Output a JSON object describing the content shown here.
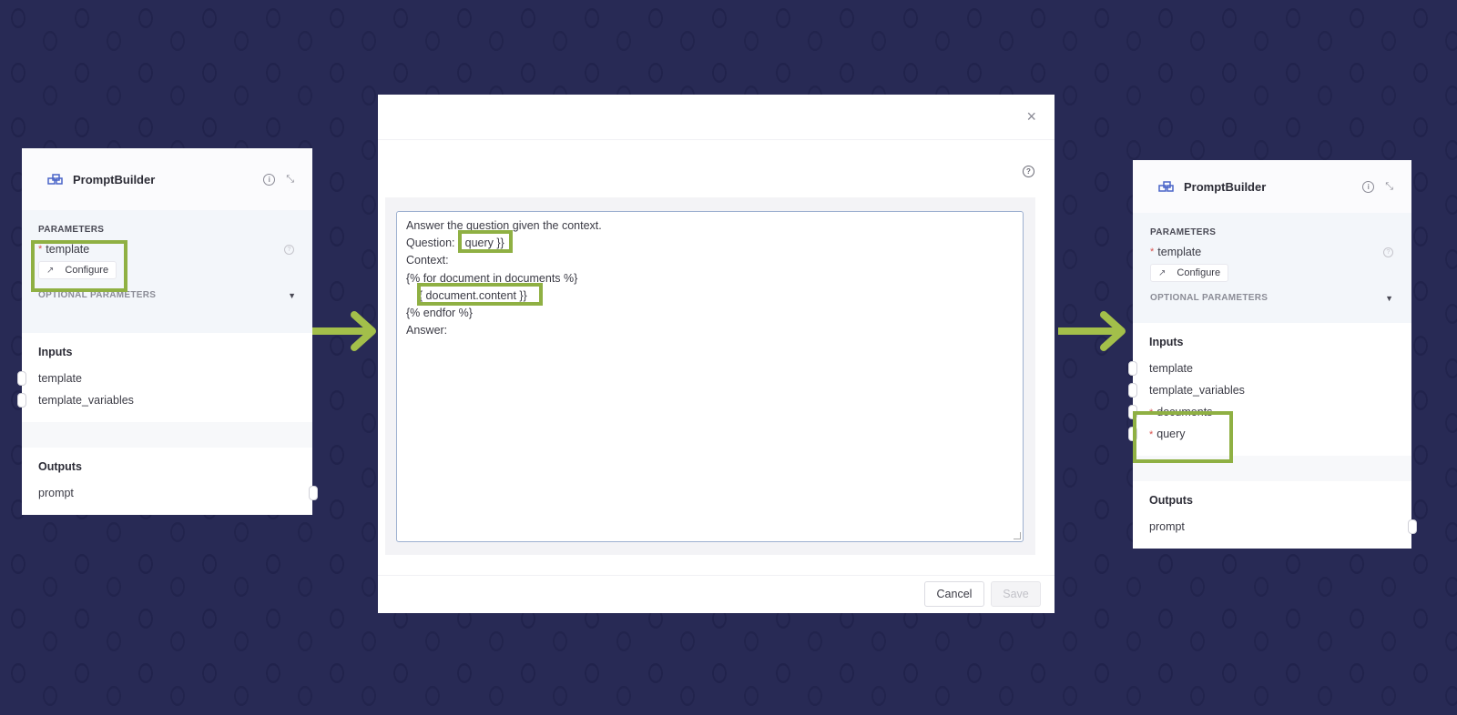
{
  "colors": {
    "background": "#282a55",
    "highlight": "#8fb043",
    "arrow": "#a3bf4a",
    "required": "#d9534f"
  },
  "left_node": {
    "title": "PromptBuilder",
    "icon": "component-icon",
    "parameters_label": "PARAMETERS",
    "param_name": "template",
    "param_required_marker": "*",
    "configure_label": "Configure",
    "optional_label": "OPTIONAL PARAMETERS",
    "inputs_title": "Inputs",
    "inputs": [
      {
        "name": "template",
        "required": false
      },
      {
        "name": "template_variables",
        "required": false
      }
    ],
    "outputs_title": "Outputs",
    "outputs": [
      {
        "name": "prompt"
      }
    ]
  },
  "modal": {
    "close_icon": "×",
    "help_icon": "?",
    "template_lines": [
      "Answer the question given the context.",
      "Question: { query }}",
      "Context:",
      "{% for document in documents %}",
      "    { document.content }}",
      "{% endfor %}",
      "Answer:"
    ],
    "cancel_label": "Cancel",
    "save_label": "Save"
  },
  "right_node": {
    "title": "PromptBuilder",
    "icon": "component-icon",
    "parameters_label": "PARAMETERS",
    "param_name": "template",
    "param_required_marker": "*",
    "configure_label": "Configure",
    "optional_label": "OPTIONAL PARAMETERS",
    "inputs_title": "Inputs",
    "inputs": [
      {
        "name": "template",
        "required": false
      },
      {
        "name": "template_variables",
        "required": false
      },
      {
        "name": "documents",
        "required": true
      },
      {
        "name": "query",
        "required": true
      }
    ],
    "outputs_title": "Outputs",
    "outputs": [
      {
        "name": "prompt"
      }
    ]
  }
}
